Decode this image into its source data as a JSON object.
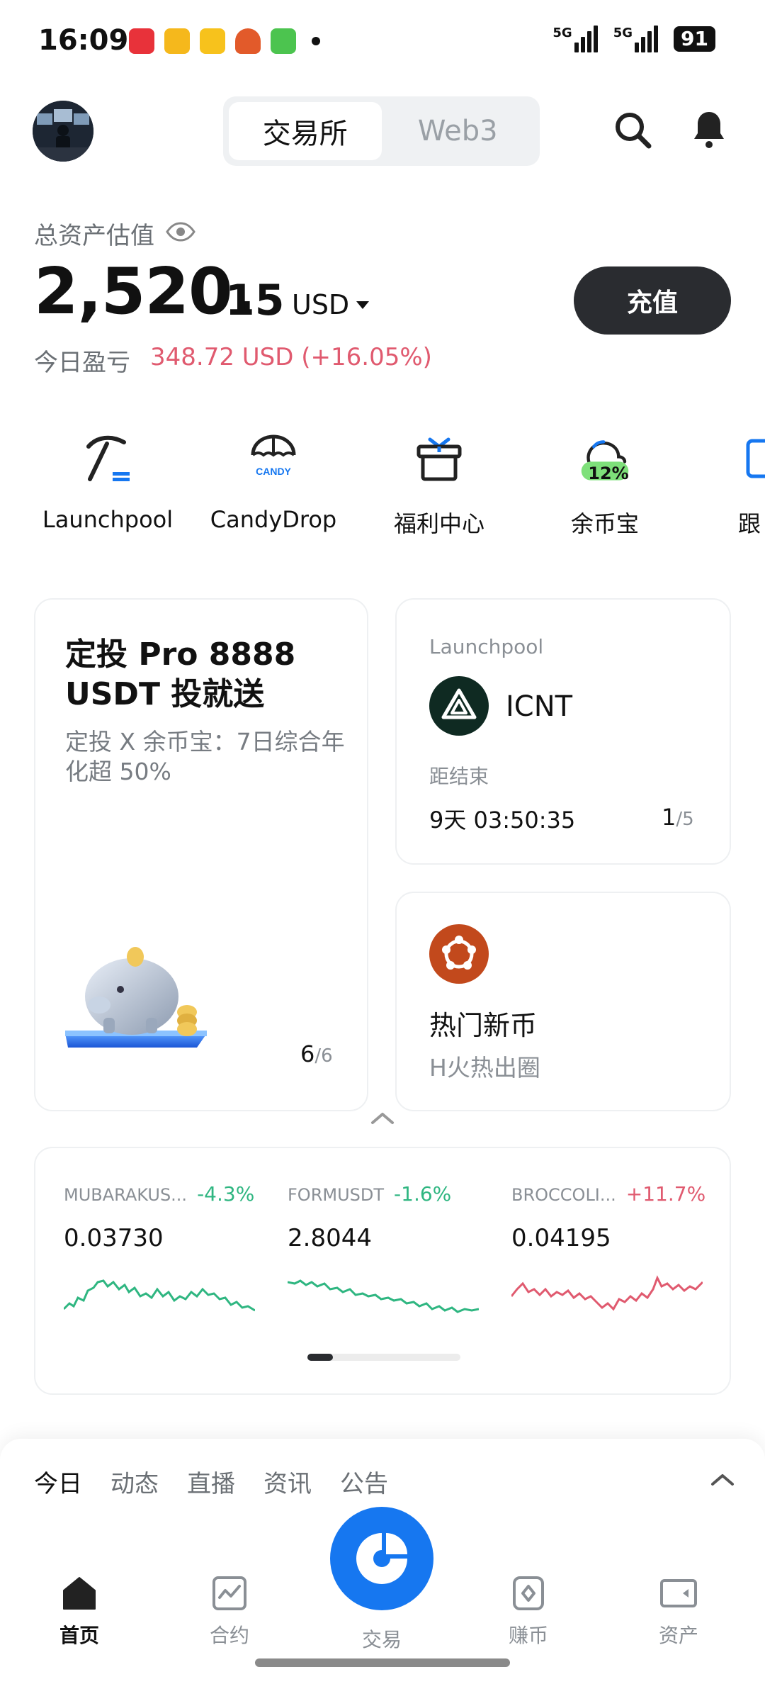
{
  "status_bar": {
    "time": "16:09",
    "signal_1": "5G",
    "signal_2": "5G",
    "battery": "91"
  },
  "header": {
    "tabs": [
      {
        "label": "交易所",
        "active": true
      },
      {
        "label": "Web3",
        "active": false
      }
    ]
  },
  "assets": {
    "label": "总资产估值",
    "value_int": "2,520.",
    "value_dec": "15",
    "currency": "USD",
    "pnl_label": "今日盈亏",
    "pnl_value": "348.72 USD",
    "pnl_pct": "(+16.05%)",
    "deposit_label": "充值"
  },
  "quick_actions": [
    {
      "label": "Launchpool",
      "icon": "pickaxe-icon"
    },
    {
      "label": "CandyDrop",
      "icon": "candy-parachute-icon"
    },
    {
      "label": "福利中心",
      "icon": "gift-icon"
    },
    {
      "label": "余币宝",
      "icon": "savings-cloud-icon",
      "badge": "12%"
    },
    {
      "label": "跟",
      "icon": "copy-trade-icon"
    }
  ],
  "promo_card": {
    "title": "定投 Pro 8888 USDT 投就送",
    "subtitle": "定投 X 余币宝：7日综合年化超 50%",
    "page_current": "6",
    "page_total": "/6"
  },
  "launchpool_card": {
    "tag": "Launchpool",
    "coin": "ICNT",
    "end_label": "距结束",
    "timer": "9天 03:50:35",
    "page_current": "1",
    "page_total": "/5"
  },
  "hot_card": {
    "title": "热门新币",
    "subtitle": "H火热出圈"
  },
  "markets": [
    {
      "name": "MUBARAKUS...",
      "change": "-4.3%",
      "price": "0.03730",
      "trend": "down"
    },
    {
      "name": "FORMUSDT",
      "change": "-1.6%",
      "price": "2.8044",
      "trend": "down"
    },
    {
      "name": "BROCCOLI...",
      "change": "+11.7%",
      "price": "0.04195",
      "trend": "up"
    }
  ],
  "colors": {
    "gain": "#e05a6f",
    "loss": "#2fb681",
    "brand": "#1677f0"
  },
  "feed_tabs": [
    "今日",
    "动态",
    "直播",
    "资讯",
    "公告"
  ],
  "bottom_nav": [
    {
      "label": "首页",
      "active": true
    },
    {
      "label": "合约",
      "active": false
    },
    {
      "label": "交易",
      "active": false
    },
    {
      "label": "赚币",
      "active": false
    },
    {
      "label": "资产",
      "active": false
    }
  ]
}
